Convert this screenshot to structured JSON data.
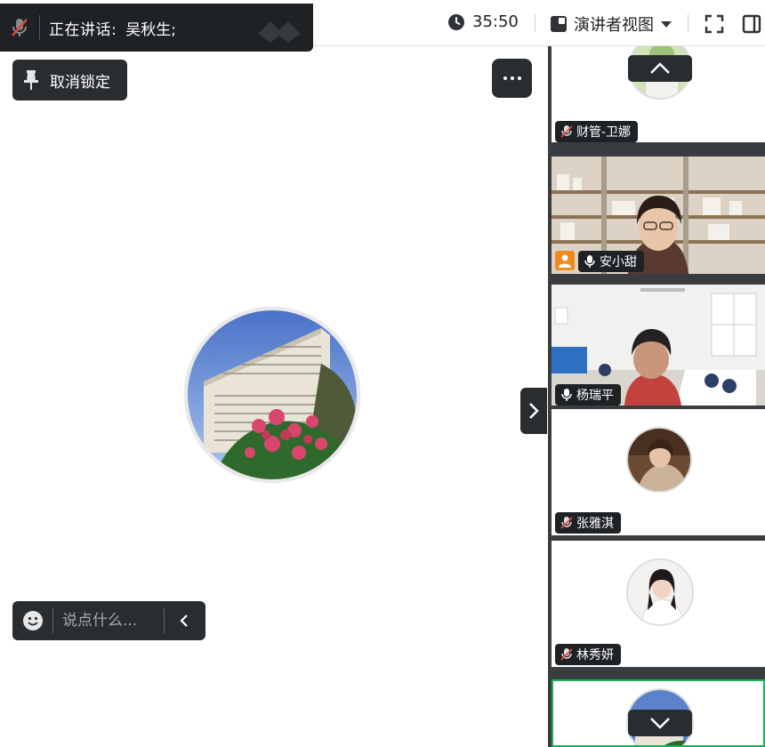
{
  "top_bar": {
    "speaking_label": "正在讲话:",
    "speaking_name": "吴秋生;",
    "timer": "35:50",
    "view_mode": "演讲者视图"
  },
  "main": {
    "unlock_label": "取消锁定",
    "chat_placeholder": "说点什么..."
  },
  "participants": [
    {
      "name": "财管-卫娜",
      "mic": "muted",
      "display": "avatar"
    },
    {
      "name": "安小甜",
      "mic": "on",
      "display": "video"
    },
    {
      "name": "杨瑞平",
      "mic": "on",
      "display": "video"
    },
    {
      "name": "张雅淇",
      "mic": "muted",
      "display": "avatar"
    },
    {
      "name": "林秀妍",
      "mic": "muted",
      "display": "avatar"
    }
  ],
  "colors": {
    "toolbar_dark": "#2a2d30",
    "active_border": "#19b35a",
    "host_badge": "#f08a1c"
  }
}
